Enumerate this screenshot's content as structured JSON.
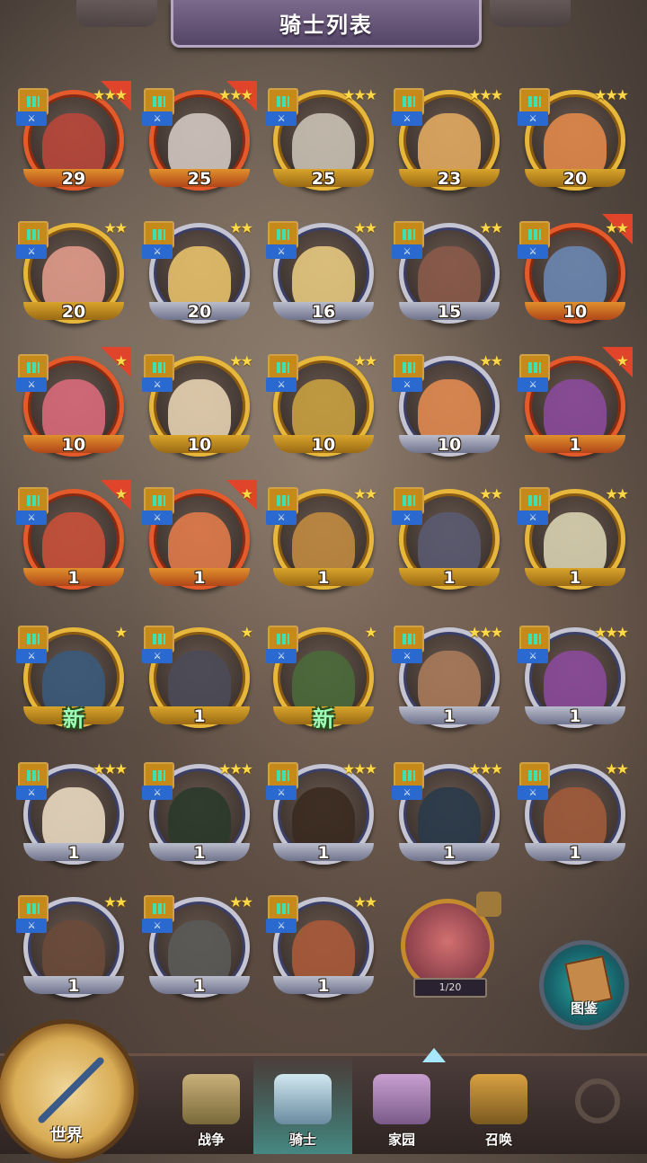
{
  "header": {
    "title": "骑士列表"
  },
  "knights": [
    {
      "level": "29",
      "stars": "★★★",
      "frame": "red",
      "color": "#b8473b"
    },
    {
      "level": "25",
      "stars": "★★★",
      "frame": "red",
      "color": "#d0c7c0"
    },
    {
      "level": "25",
      "stars": "★★★",
      "frame": "gold",
      "color": "#c9c0b4"
    },
    {
      "level": "23",
      "stars": "★★★",
      "frame": "gold",
      "color": "#e0a860"
    },
    {
      "level": "20",
      "stars": "★★★",
      "frame": "gold",
      "color": "#e0884a"
    },
    {
      "level": "20",
      "stars": "★★",
      "frame": "gold",
      "color": "#e09a8a"
    },
    {
      "level": "20",
      "stars": "★★",
      "frame": "silver",
      "color": "#e6c06a"
    },
    {
      "level": "16",
      "stars": "★★",
      "frame": "silver",
      "color": "#e6c880"
    },
    {
      "level": "15",
      "stars": "★★",
      "frame": "silver",
      "color": "#8a5a4a"
    },
    {
      "level": "10",
      "stars": "★★",
      "frame": "red",
      "color": "#6a86b0"
    },
    {
      "level": "10",
      "stars": "★",
      "frame": "red",
      "color": "#d86a7a"
    },
    {
      "level": "10",
      "stars": "★★",
      "frame": "gold",
      "color": "#e6d0b0"
    },
    {
      "level": "10",
      "stars": "★★",
      "frame": "gold",
      "color": "#c8a040"
    },
    {
      "level": "10",
      "stars": "★★",
      "frame": "silver",
      "color": "#e08a50"
    },
    {
      "level": "1",
      "stars": "★",
      "frame": "red",
      "color": "#8a4a9a"
    },
    {
      "level": "1",
      "stars": "★",
      "frame": "red",
      "color": "#c8503a"
    },
    {
      "level": "1",
      "stars": "★",
      "frame": "red",
      "color": "#e07a4a"
    },
    {
      "level": "1",
      "stars": "★★",
      "frame": "gold",
      "color": "#c08a40"
    },
    {
      "level": "1",
      "stars": "★★",
      "frame": "gold",
      "color": "#5a5a70"
    },
    {
      "level": "1",
      "stars": "★★",
      "frame": "gold",
      "color": "#d8d0b0"
    },
    {
      "level": "新",
      "stars": "★",
      "frame": "gold",
      "color": "#3a5a7a"
    },
    {
      "level": "1",
      "stars": "★",
      "frame": "gold",
      "color": "#4a4a58"
    },
    {
      "level": "新",
      "stars": "★",
      "frame": "gold",
      "color": "#4a6a3a"
    },
    {
      "level": "1",
      "stars": "★★★",
      "frame": "silver",
      "color": "#a87a5a"
    },
    {
      "level": "1",
      "stars": "★★★",
      "frame": "silver",
      "color": "#8a4a9a"
    },
    {
      "level": "1",
      "stars": "★★★",
      "frame": "silver",
      "color": "#e8d8c0"
    },
    {
      "level": "1",
      "stars": "★★★",
      "frame": "silver",
      "color": "#2a3a2a"
    },
    {
      "level": "1",
      "stars": "★★★",
      "frame": "silver",
      "color": "#3a2a20"
    },
    {
      "level": "1",
      "stars": "★★★",
      "frame": "silver",
      "color": "#2a3a4a"
    },
    {
      "level": "1",
      "stars": "★★",
      "frame": "silver",
      "color": "#a05a3a"
    },
    {
      "level": "1",
      "stars": "★★",
      "frame": "silver",
      "color": "#6a4a3a"
    },
    {
      "level": "1",
      "stars": "★★",
      "frame": "silver",
      "color": "#5a5a58"
    },
    {
      "level": "1",
      "stars": "★★",
      "frame": "silver",
      "color": "#a85a3a"
    }
  ],
  "fragment": {
    "progress": "1/20"
  },
  "codex": {
    "label": "图鉴"
  },
  "nav": {
    "world": "世界",
    "items": [
      {
        "label": "战争"
      },
      {
        "label": "骑士"
      },
      {
        "label": "家园"
      },
      {
        "label": "召唤"
      }
    ]
  },
  "colors": {
    "gold_frame": "#e6b73a",
    "silver_frame": "#c4c4d2",
    "red_frame": "#e45a2a",
    "class_badge": "#c58a1a",
    "role_badge": "#2a6ad0",
    "stars": "#ffd84a"
  }
}
